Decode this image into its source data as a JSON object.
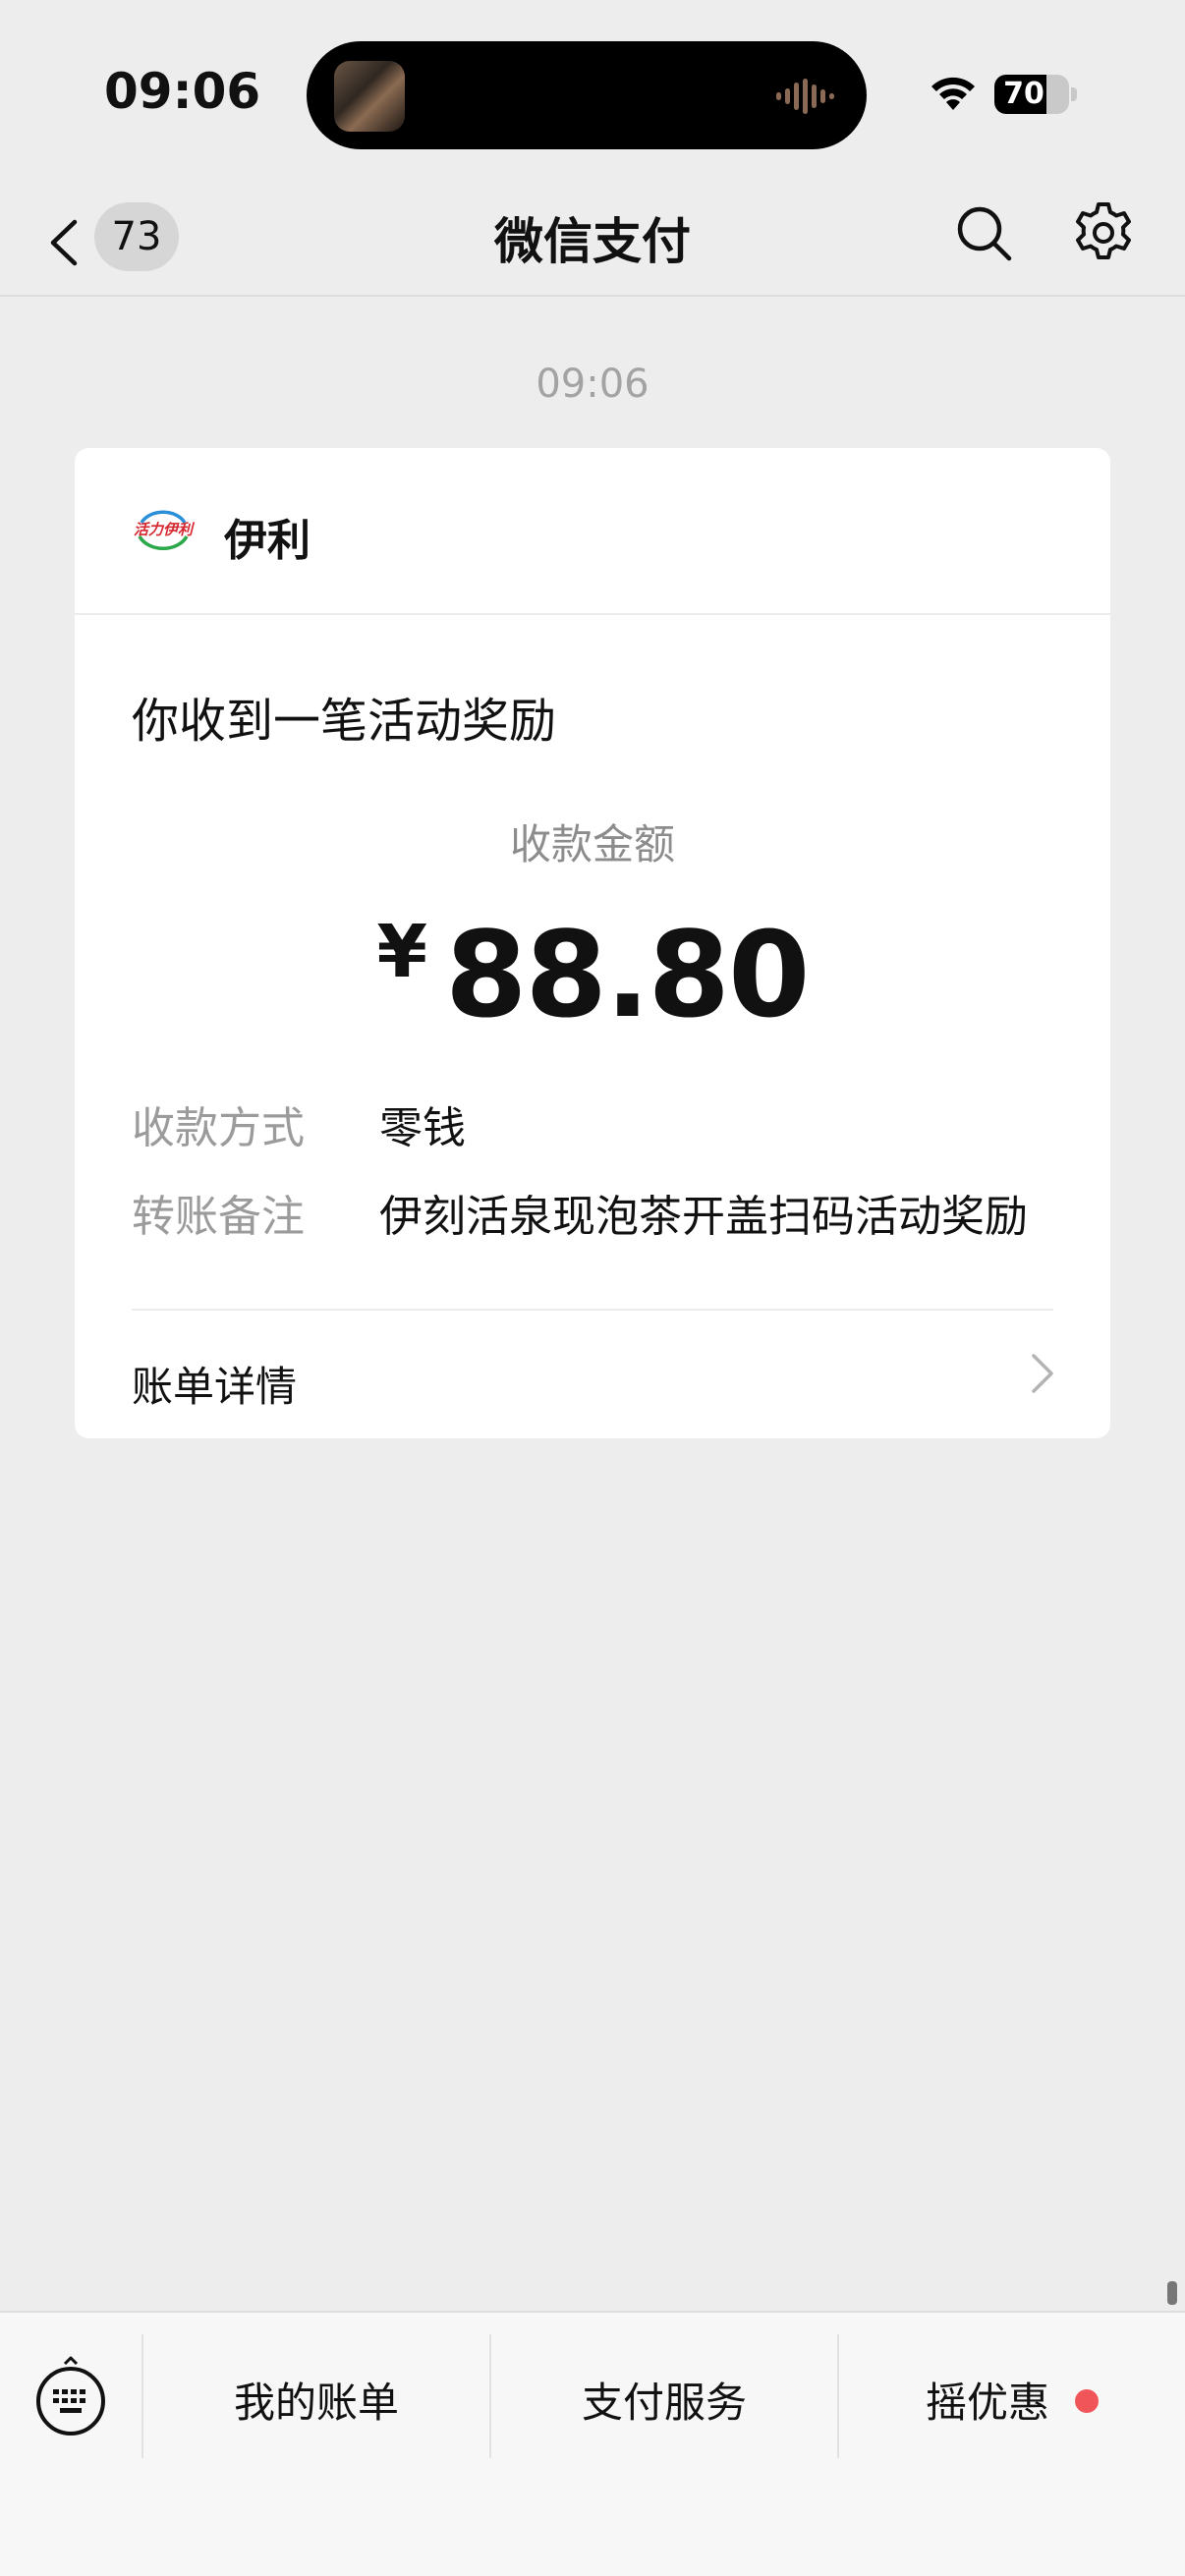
{
  "status_bar": {
    "time": "09:06",
    "battery_percent": "70",
    "battery_level": 0.7
  },
  "nav": {
    "unread_count": "73",
    "title": "微信支付"
  },
  "message": {
    "time": "09:06",
    "card": {
      "brand_name": "伊利",
      "logo_text": "活力伊利",
      "title": "你收到一笔活动奖励",
      "amount_label": "收款金额",
      "currency": "¥",
      "amount": "88.80",
      "rows": [
        {
          "key": "收款方式",
          "value": "零钱"
        },
        {
          "key": "转账备注",
          "value": "伊刻活泉现泡茶开盖扫码活动奖励"
        }
      ],
      "detail_label": "账单详情"
    }
  },
  "bottom_menu": {
    "items": [
      {
        "label": "我的账单"
      },
      {
        "label": "支付服务"
      },
      {
        "label": "摇优惠"
      }
    ]
  },
  "colors": {
    "background": "#ededed",
    "card": "#ffffff",
    "secondary_text": "#8c8c8c",
    "notification_dot": "#f0555a"
  },
  "icons": [
    "wifi-icon",
    "back-chevron-icon",
    "search-icon",
    "gear-icon",
    "chevron-right-icon",
    "keyboard-icon"
  ]
}
